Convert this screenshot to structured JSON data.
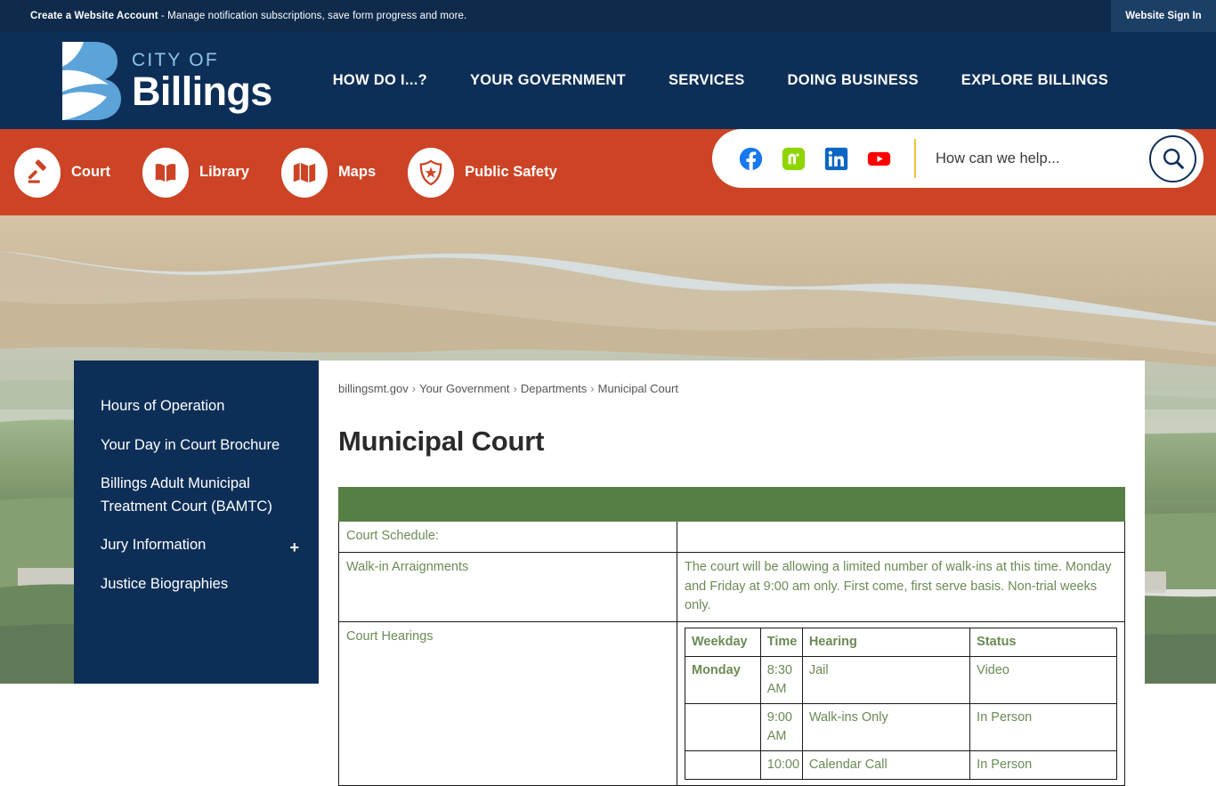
{
  "topbar": {
    "account_strong": "Create a Website Account",
    "account_rest": " - Manage notification subscriptions, save form progress and more.",
    "signin_label": "Website Sign In"
  },
  "header": {
    "logo_city": "CITY OF",
    "logo_name": "Billings",
    "nav": [
      {
        "label": "HOW DO I...?"
      },
      {
        "label": "YOUR GOVERNMENT"
      },
      {
        "label": "SERVICES"
      },
      {
        "label": "DOING BUSINESS"
      },
      {
        "label": "EXPLORE BILLINGS"
      }
    ]
  },
  "quickbar": {
    "links": [
      {
        "label": "Court",
        "icon": "gavel-icon"
      },
      {
        "label": "Library",
        "icon": "book-icon"
      },
      {
        "label": "Maps",
        "icon": "map-icon"
      },
      {
        "label": "Public Safety",
        "icon": "badge-icon"
      }
    ],
    "social": [
      {
        "name": "facebook-icon",
        "color": "#1877f2"
      },
      {
        "name": "nextdoor-icon",
        "color": "#8ed500"
      },
      {
        "name": "linkedin-icon",
        "color": "#0a66c2"
      },
      {
        "name": "youtube-icon",
        "color": "#ff0000"
      }
    ],
    "search_placeholder": "How can we help...",
    "search_value": ""
  },
  "sidebar": {
    "items": [
      {
        "label": "Hours of Operation",
        "expandable": false
      },
      {
        "label": "Your Day in Court Brochure",
        "expandable": false
      },
      {
        "label": "Billings Adult Municipal Treatment Court (BAMTC)",
        "expandable": false
      },
      {
        "label": "Jury Information",
        "expandable": true,
        "expand_glyph": "+"
      },
      {
        "label": "Justice Biographies",
        "expandable": false
      }
    ]
  },
  "main": {
    "breadcrumb": [
      "billingsmt.gov",
      "Your Government",
      "Departments",
      "Municipal Court"
    ],
    "breadcrumb_separator": "›",
    "page_title": "Municipal Court",
    "table": {
      "header_color": "#567f45",
      "rows": [
        {
          "type": "header",
          "left": "",
          "right": ""
        },
        {
          "type": "text",
          "left": "Court Schedule:",
          "right": ""
        },
        {
          "type": "text",
          "left": "Walk-in Arraignments",
          "right": "The court will be allowing a limited number of walk-ins at this time.  Monday and Friday at 9:00 am only.  First come, first serve basis. Non-trial weeks only."
        },
        {
          "type": "nested",
          "left": "Court Hearings",
          "inner": {
            "columns": [
              "Weekday",
              "Time",
              "Hearing",
              "Status"
            ],
            "rows": [
              {
                "weekday": "Monday",
                "time": "8:30 AM",
                "hearing": "Jail",
                "status": "Video"
              },
              {
                "weekday": "",
                "time": "9:00 AM",
                "hearing": "Walk-ins Only",
                "status": "In Person"
              },
              {
                "weekday": "",
                "time": "10:00",
                "hearing": "Calendar Call",
                "status": "In Person"
              }
            ]
          }
        }
      ]
    }
  },
  "colors": {
    "navy": "#0d2f57",
    "topbar_navy": "#0f2b4c",
    "orange": "#cc4425",
    "green": "#567f45",
    "table_text": "#6b8a55",
    "logo_blue": "#8fc4e8"
  }
}
